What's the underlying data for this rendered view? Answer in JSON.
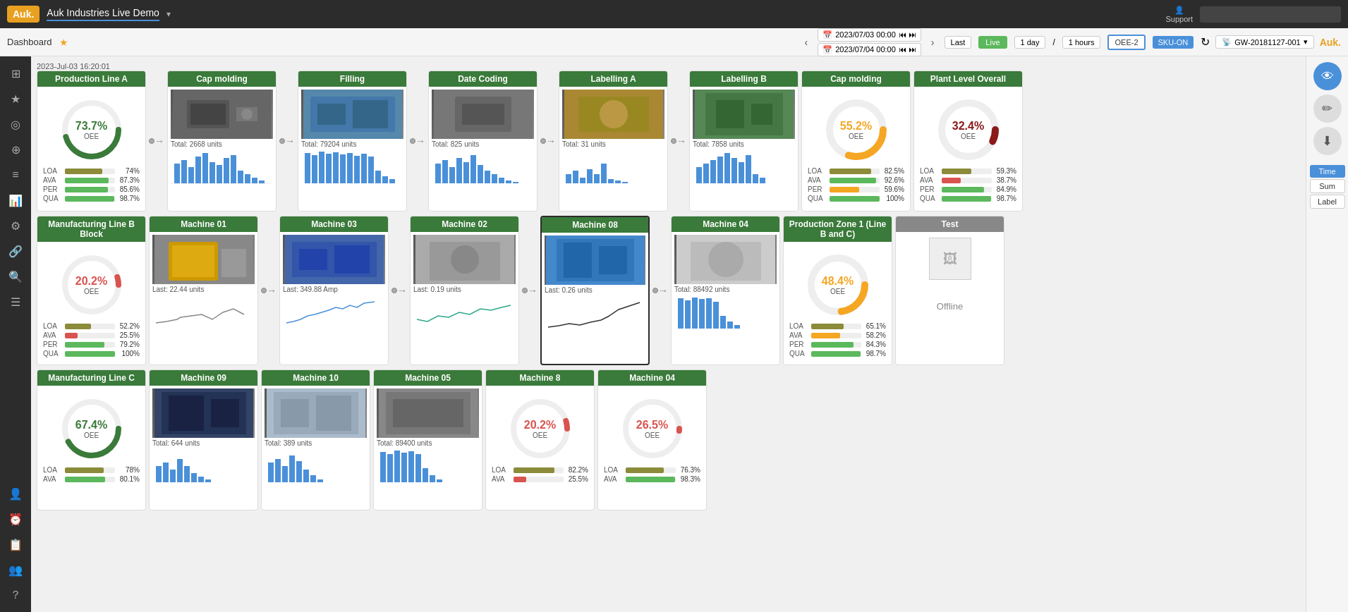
{
  "app": {
    "logo": "Auk.",
    "title": "Auk Industries Live Demo",
    "support_label": "Support",
    "brand": "Auk."
  },
  "subheader": {
    "breadcrumb": "Dashboard",
    "timestamp": "2023-Jul-03 16:20:01",
    "date_from": "2023/07/03 00:00",
    "date_to": "2023/07/04 00:00",
    "last_label": "Last",
    "duration": "1 day",
    "period": "1 hours",
    "live_label": "Live",
    "oee2_label": "OEE-2",
    "sku_label": "SKU-ON",
    "refresh_icon": "↻",
    "gw_label": "GW-20181127-001"
  },
  "sidebar": {
    "items": [
      "⊞",
      "★",
      "◎",
      "⊕",
      "≡",
      "📊",
      "⚙",
      "🔗",
      "🔍",
      "☰",
      "👤",
      "⏰",
      "📋",
      "👥",
      "？"
    ]
  },
  "rows": [
    {
      "id": "row1",
      "cards": [
        {
          "id": "prod-line-a",
          "title": "Production Line A",
          "type": "oee_circle",
          "oee_pct": "73.7%",
          "oee_color": "#3a7a3a",
          "metrics": [
            {
              "label": "LOA",
              "val": "74%",
              "pct": 74,
              "color": "#b0b050"
            },
            {
              "label": "AVA",
              "val": "87.3%",
              "pct": 87.3,
              "color": "#5cb85c"
            },
            {
              "label": "PER",
              "val": "85.6%",
              "pct": 85.6,
              "color": "#5cb85c"
            },
            {
              "label": "QUA",
              "val": "98.7%",
              "pct": 98.7,
              "color": "#5cb85c"
            }
          ]
        },
        {
          "id": "arrow1",
          "type": "arrow"
        },
        {
          "id": "cap-molding-1",
          "title": "Cap molding",
          "type": "image_chart",
          "total": "Total: 2668 units",
          "image_desc": "cap molding machine"
        },
        {
          "id": "arrow2",
          "type": "arrow"
        },
        {
          "id": "filling",
          "title": "Filling",
          "type": "image_chart",
          "total": "Total: 79204 units",
          "image_desc": "filling machine"
        },
        {
          "id": "arrow3",
          "type": "arrow"
        },
        {
          "id": "date-coding",
          "title": "Date Coding",
          "type": "image_chart",
          "total": "Total: 825 units",
          "image_desc": "date coding machine"
        },
        {
          "id": "arrow4",
          "type": "arrow"
        },
        {
          "id": "labelling-a",
          "title": "Labelling A",
          "type": "image_chart",
          "total": "Total: 31 units",
          "image_desc": "labelling machine a"
        },
        {
          "id": "arrow5",
          "type": "arrow"
        },
        {
          "id": "labelling-b",
          "title": "Labelling B",
          "type": "image_chart",
          "total": "Total: 7858 units",
          "image_desc": "labelling machine b"
        },
        {
          "id": "spacer1",
          "type": "spacer"
        },
        {
          "id": "cap-molding-2",
          "title": "Cap molding",
          "type": "oee_donut",
          "oee_pct": "55.2%",
          "oee_color": "#f5a623",
          "metrics": [
            {
              "label": "LOA",
              "val": "82.5%",
              "pct": 82.5,
              "color": "#b0b050"
            },
            {
              "label": "AVA",
              "val": "92.6%",
              "pct": 92.6,
              "color": "#5cb85c"
            },
            {
              "label": "PER",
              "val": "59.6%",
              "pct": 59.6,
              "color": "#f5a623"
            },
            {
              "label": "QUA",
              "val": "100%",
              "pct": 100,
              "color": "#5cb85c"
            }
          ]
        },
        {
          "id": "plant-level",
          "title": "Plant Level Overall",
          "type": "oee_donut",
          "oee_pct": "32.4%",
          "oee_color": "#8b1a1a",
          "metrics": [
            {
              "label": "LOA",
              "val": "59.3%",
              "pct": 59.3,
              "color": "#b0b050"
            },
            {
              "label": "AVA",
              "val": "38.7%",
              "pct": 38.7,
              "color": "#d9534f"
            },
            {
              "label": "PER",
              "val": "84.9%",
              "pct": 84.9,
              "color": "#5cb85c"
            },
            {
              "label": "QUA",
              "val": "98.7%",
              "pct": 98.7,
              "color": "#5cb85c"
            }
          ]
        }
      ]
    },
    {
      "id": "row2",
      "cards": [
        {
          "id": "mfg-line-b",
          "title": "Manufacturing Line B Block",
          "type": "oee_circle",
          "oee_pct": "20.2%",
          "oee_color": "#d9534f",
          "metrics": [
            {
              "label": "LOA",
              "val": "52.2%",
              "pct": 52.2,
              "color": "#b0b050"
            },
            {
              "label": "AVA",
              "val": "25.5%",
              "pct": 25.5,
              "color": "#d9534f"
            },
            {
              "label": "PER",
              "val": "79.2%",
              "pct": 79.2,
              "color": "#5cb85c"
            },
            {
              "label": "QUA",
              "val": "100%",
              "pct": 100,
              "color": "#5cb85c"
            }
          ]
        },
        {
          "id": "machine-01",
          "title": "Machine 01",
          "type": "image_linechart",
          "last": "Last: 22.44 units",
          "image_desc": "yellow injection machine"
        },
        {
          "id": "arrow6",
          "type": "arrow"
        },
        {
          "id": "machine-03",
          "title": "Machine 03",
          "type": "image_linechart",
          "last": "Last: 349.88 Amp",
          "image_desc": "machine 03"
        },
        {
          "id": "arrow7",
          "type": "arrow"
        },
        {
          "id": "machine-02",
          "title": "Machine 02",
          "type": "image_linechart",
          "last": "Last: 0.19 units",
          "image_desc": "machine 02"
        },
        {
          "id": "arrow8",
          "type": "arrow"
        },
        {
          "id": "machine-08",
          "title": "Machine 08",
          "type": "image_linechart",
          "last": "Last: 0.26 units",
          "image_desc": "machine 08",
          "highlighted": true
        },
        {
          "id": "arrow9",
          "type": "arrow"
        },
        {
          "id": "machine-04",
          "title": "Machine 04",
          "type": "image_chart",
          "total": "Total: 88492 units",
          "image_desc": "machine 04"
        },
        {
          "id": "spacer2",
          "type": "spacer"
        },
        {
          "id": "prod-zone-1",
          "title": "Production Zone 1 (Line B and C)",
          "type": "oee_donut",
          "oee_pct": "48.4%",
          "oee_color": "#f5a623",
          "metrics": [
            {
              "label": "LOA",
              "val": "65.1%",
              "pct": 65.1,
              "color": "#b0b050"
            },
            {
              "label": "AVA",
              "val": "58.2%",
              "pct": 58.2,
              "color": "#f5a623"
            },
            {
              "label": "PER",
              "val": "84.3%",
              "pct": 84.3,
              "color": "#5cb85c"
            },
            {
              "label": "QUA",
              "val": "98.7%",
              "pct": 98.7,
              "color": "#5cb85c"
            }
          ]
        },
        {
          "id": "test-card",
          "title": "Test",
          "type": "offline",
          "offline_text": "Offline"
        }
      ]
    },
    {
      "id": "row3",
      "cards": [
        {
          "id": "mfg-line-c",
          "title": "Manufacturing Line C",
          "type": "oee_circle",
          "oee_pct": "67.4%",
          "oee_color": "#3a7a3a",
          "metrics": [
            {
              "label": "LOA",
              "val": "78%",
              "pct": 78,
              "color": "#b0b050"
            },
            {
              "label": "AVA",
              "val": "80.1%",
              "pct": 80.1,
              "color": "#5cb85c"
            }
          ]
        },
        {
          "id": "machine-09",
          "title": "Machine 09",
          "type": "image_chart",
          "total": "Total: 644 units",
          "image_desc": "machine 09 blue"
        },
        {
          "id": "machine-10",
          "title": "Machine 10",
          "type": "image_chart",
          "total": "Total: 389 units",
          "image_desc": "machine 10"
        },
        {
          "id": "machine-05",
          "title": "Machine 05",
          "type": "image_chart",
          "total": "Total: 89400 units",
          "image_desc": "machine 05"
        },
        {
          "id": "machine-8b",
          "title": "Machine 8",
          "type": "oee_circle",
          "oee_pct": "20.2%",
          "oee_color": "#d9534f",
          "metrics": [
            {
              "label": "LOA",
              "val": "82.2%",
              "pct": 82.2,
              "color": "#b0b050"
            },
            {
              "label": "AVA",
              "val": "25.5%",
              "pct": 25.5,
              "color": "#d9534f"
            }
          ]
        },
        {
          "id": "machine-04b",
          "title": "Machine 04",
          "type": "oee_circle",
          "oee_pct": "26.5%",
          "oee_color": "#d9534f",
          "metrics": [
            {
              "label": "LOA",
              "val": "76.3%",
              "pct": 76.3,
              "color": "#b0b050"
            },
            {
              "label": "AVA",
              "val": "98.3%",
              "pct": 98.3,
              "color": "#5cb85c"
            }
          ]
        }
      ]
    }
  ],
  "right_panel": {
    "view_btn": "👁",
    "edit_btn": "✏",
    "download_btn": "⬇",
    "tabs": [
      "Time",
      "Sum",
      "Label"
    ]
  }
}
